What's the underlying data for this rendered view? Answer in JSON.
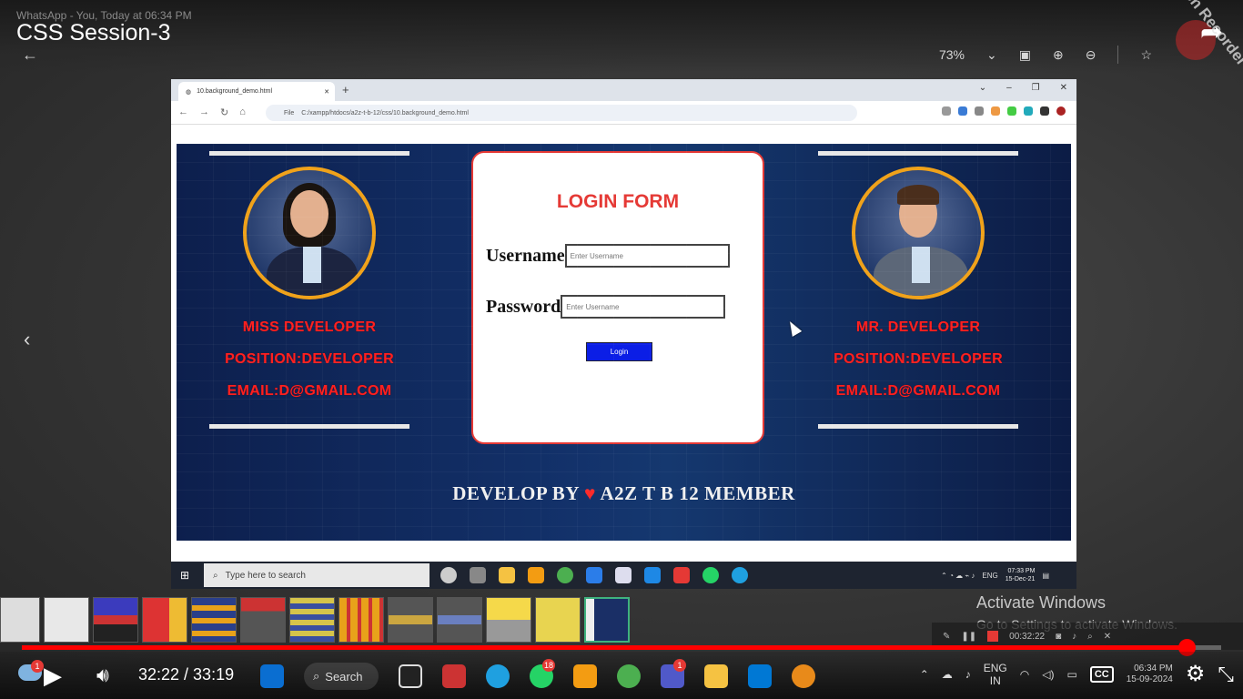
{
  "overlay": {
    "whatsapp_caption": "WhatsApp - You, Today at 06:34 PM",
    "video_title": "CSS Session-3",
    "zoom": "73%",
    "watermark": "iTop Screen Recorder"
  },
  "browser": {
    "tab_title": "10.background_demo.html",
    "url_prefix": "File",
    "url": "C:/xampp/htdocs/a2z-t-b-12/css/10.background_demo.html"
  },
  "profiles": [
    {
      "name": "MISS DEVELOPER",
      "position": "POSITION:DEVELOPER",
      "email": "EMAIL:D@GMAIL.COM"
    },
    {
      "name": "MR. DEVELOPER",
      "position": "POSITION:DEVELOPER",
      "email": "EMAIL:D@GMAIL.COM"
    }
  ],
  "login": {
    "title": "LOGIN FORM",
    "username_label": "Username",
    "username_placeholder": "Enter Username",
    "password_label": "Password",
    "password_placeholder": "Enter Username",
    "button": "Login"
  },
  "footer": {
    "prefix": "DEVELOP BY",
    "heart": "♥",
    "suffix": "A2Z T B 12 MEMBER"
  },
  "inner_taskbar": {
    "search_placeholder": "Type here to search",
    "lang": "ENG",
    "time": "07:33 PM",
    "date": "15-Dec-21"
  },
  "activate_windows": {
    "title": "Activate Windows",
    "subtitle": "Go to Settings to activate Windows."
  },
  "recorder": {
    "timer": "00:32:22"
  },
  "player": {
    "current_time": "32:22",
    "duration": "33:19",
    "time_display": "32:22 / 33:19",
    "progress_fraction": 0.9715
  },
  "host_taskbar": {
    "search_label": "Search",
    "weather_badge": "1",
    "whatsapp_badge": "18",
    "teams_badge": "1",
    "lang_top": "ENG",
    "lang_bottom": "IN",
    "cc_label": "CC",
    "time": "06:34 PM",
    "date": "15-09-2024"
  },
  "colors": {
    "accent_red": "#ff0000",
    "login_button": "#0b1ee6",
    "profile_text": "#ff2020",
    "avatar_ring": "#f0a21a"
  }
}
